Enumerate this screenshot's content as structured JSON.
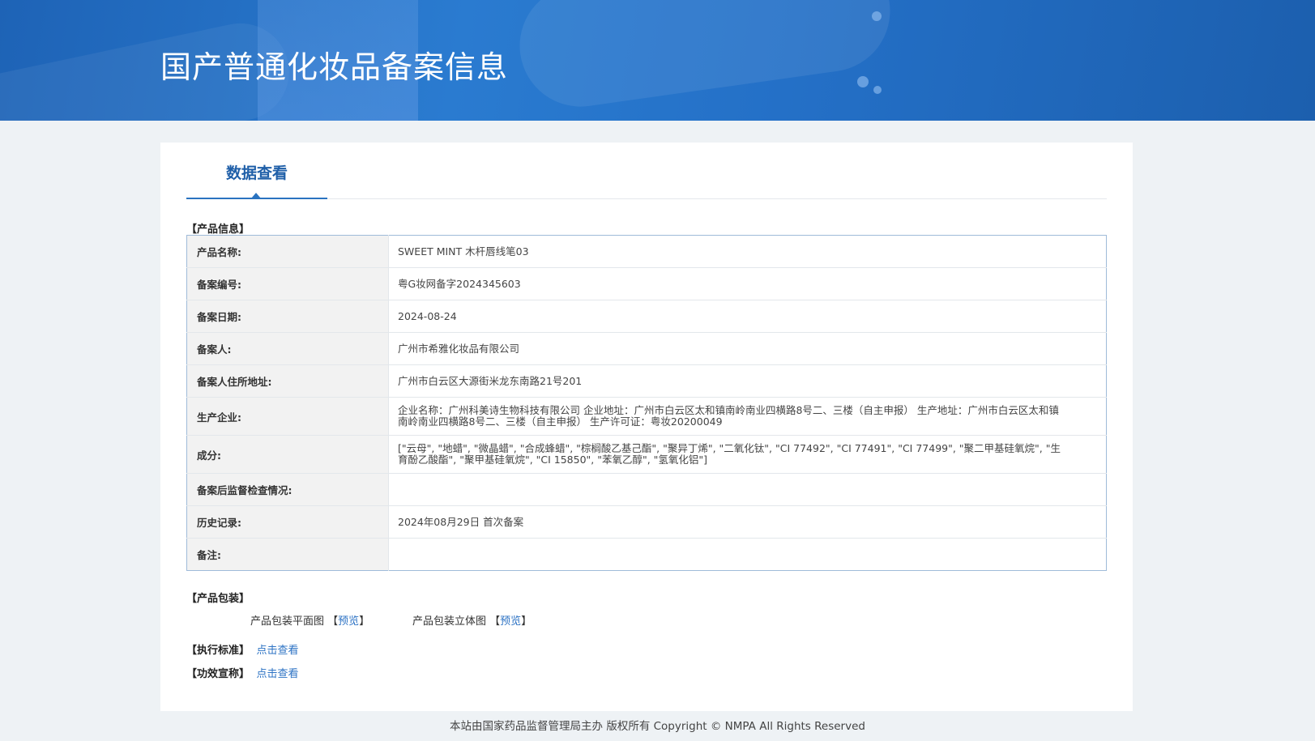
{
  "header": {
    "title": "国产普通化妆品备案信息"
  },
  "tabs": [
    {
      "label": "数据查看"
    }
  ],
  "sections": {
    "product_info": "【产品信息】",
    "packaging": "【产品包装】",
    "standard": "【执行标准】",
    "efficacy": "【功效宣称】"
  },
  "product_rows": [
    {
      "label": "产品名称:",
      "value": "SWEET MINT 木杆唇线笔03"
    },
    {
      "label": "备案编号:",
      "value": "粤G妆网备字2024345603"
    },
    {
      "label": "备案日期:",
      "value": "2024-08-24"
    },
    {
      "label": "备案人:",
      "value": "广州市希雅化妆品有限公司"
    },
    {
      "label": "备案人住所地址:",
      "value": "广州市白云区大源街米龙东南路21号201"
    },
    {
      "label": "生产企业:",
      "value": "企业名称：广州科美诗生物科技有限公司 企业地址：广州市白云区太和镇南岭南业四横路8号二、三楼（自主申报） 生产地址：广州市白云区太和镇南岭南业四横路8号二、三楼（自主申报） 生产许可证：粤妆20200049"
    },
    {
      "label": "成分:",
      "value": "[\"云母\", \"地蜡\", \"微晶蜡\", \"合成蜂蜡\", \"棕榈酸乙基己酯\", \"聚异丁烯\", \"二氧化钛\", \"CI 77492\", \"CI 77491\", \"CI 77499\", \"聚二甲基硅氧烷\", \"生育酚乙酸酯\", \"聚甲基硅氧烷\", \"CI 15850\", \"苯氧乙醇\", \"氢氧化铝\"]"
    },
    {
      "label": "备案后监督检查情况:",
      "value": ""
    },
    {
      "label": "历史记录:",
      "value": "2024年08月29日 首次备案"
    },
    {
      "label": "备注:",
      "value": ""
    }
  ],
  "packaging": {
    "flat_label": "产品包装平面图",
    "flat_link": "预览",
    "solid_label": "产品包装立体图",
    "solid_link": "预览",
    "bracket_open": "【",
    "bracket_close": "】"
  },
  "standard_link": "点击查看",
  "efficacy_link": "点击查看",
  "footer": {
    "text": "本站由国家药品监督管理局主办 版权所有 Copyright © NMPA All Rights Reserved"
  },
  "colors": {
    "banner": "#2470c7",
    "accent": "#1f5fa8",
    "link": "#2d73c4"
  }
}
